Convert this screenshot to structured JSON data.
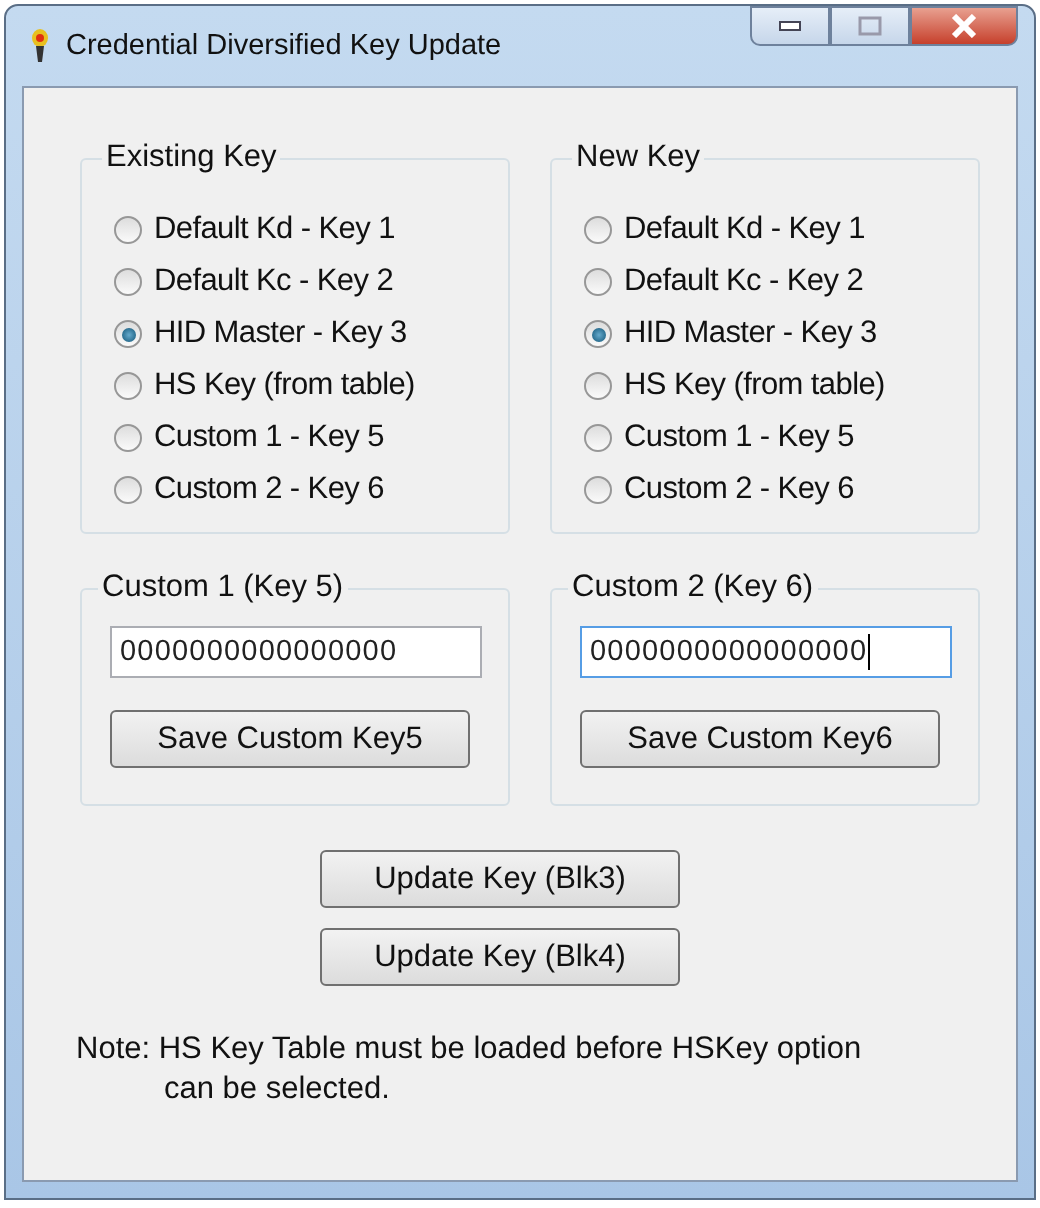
{
  "window": {
    "title": "Credential Diversified Key Update"
  },
  "key_groups": [
    {
      "title": "Existing Key",
      "options": [
        {
          "label": "Default Kd - Key 1",
          "selected": false
        },
        {
          "label": "Default Kc - Key 2",
          "selected": false
        },
        {
          "label": "HID Master - Key 3",
          "selected": true
        },
        {
          "label": "HS Key (from table)",
          "selected": false
        },
        {
          "label": "Custom 1 - Key 5",
          "selected": false
        },
        {
          "label": "Custom 2 - Key 6",
          "selected": false
        }
      ]
    },
    {
      "title": "New Key",
      "options": [
        {
          "label": "Default Kd - Key 1",
          "selected": false
        },
        {
          "label": "Default Kc - Key 2",
          "selected": false
        },
        {
          "label": "HID Master - Key 3",
          "selected": true
        },
        {
          "label": "HS Key (from table)",
          "selected": false
        },
        {
          "label": "Custom 1 - Key 5",
          "selected": false
        },
        {
          "label": "Custom 2 - Key 6",
          "selected": false
        }
      ]
    }
  ],
  "custom_groups": [
    {
      "title": "Custom 1 (Key 5)",
      "value": "0000000000000000",
      "focused": false,
      "button": "Save Custom Key5"
    },
    {
      "title": "Custom 2 (Key 6)",
      "value": "0000000000000000",
      "focused": true,
      "button": "Save Custom Key6"
    }
  ],
  "buttons": [
    "Update Key (Blk3)",
    "Update Key (Blk4)"
  ],
  "note": "Note: HS Key Table must be loaded before HSKey option can be selected."
}
